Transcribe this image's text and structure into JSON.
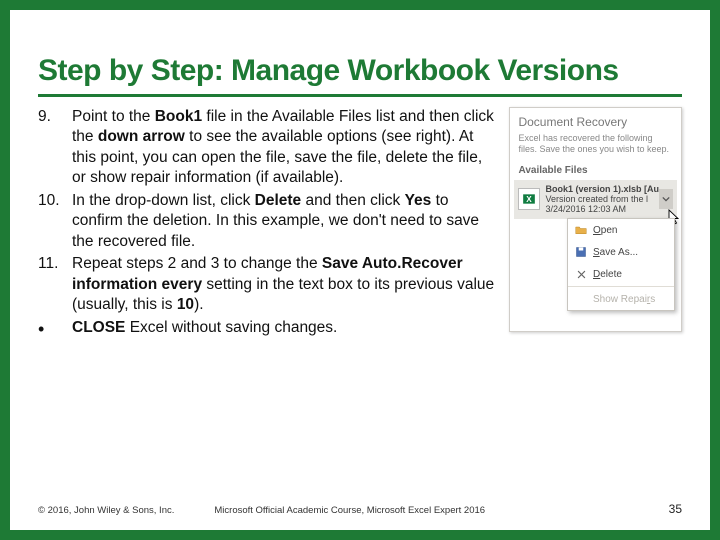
{
  "title": "Step by Step: Manage Workbook Versions",
  "steps": [
    {
      "num": "9.",
      "segments": [
        {
          "t": "Point to the "
        },
        {
          "t": "Book1",
          "b": true
        },
        {
          "t": " file in the Available Files list and then click the "
        },
        {
          "t": "down arrow",
          "b": true
        },
        {
          "t": " to see the available options (see right). At this point, you can open the file, save the file, delete the file, or show repair information (if available)."
        }
      ]
    },
    {
      "num": "10.",
      "segments": [
        {
          "t": "In the drop-down list, click "
        },
        {
          "t": "Delete",
          "b": true
        },
        {
          "t": " and then click "
        },
        {
          "t": "Yes",
          "b": true
        },
        {
          "t": " to confirm the deletion. In this example, we don't need to save the recovered file."
        }
      ]
    },
    {
      "num": "11.",
      "segments": [
        {
          "t": "Repeat steps 2 and 3 to change the "
        },
        {
          "t": "Save Auto.Recover information every",
          "b": true
        },
        {
          "t": " setting in the text box to its previous value (usually, this is "
        },
        {
          "t": "10",
          "b": true
        },
        {
          "t": ")."
        }
      ]
    }
  ],
  "bullet": {
    "mark": "•",
    "segments": [
      {
        "t": "CLOSE",
        "b": true
      },
      {
        "t": " Excel without saving changes."
      }
    ]
  },
  "figure": {
    "title": "Document Recovery",
    "subtitle": "Excel has recovered the following files. Save the ones you wish to keep.",
    "available_label": "Available Files",
    "file": {
      "name": "Book1 (version 1).xlsb  [Au",
      "line2": "Version created from the l",
      "line3": "3/24/2016 12:03 AM"
    },
    "menu": {
      "open": "Open",
      "save_as": "Save As...",
      "delete": "Delete",
      "show_repairs": "Show Repairs"
    }
  },
  "footer": {
    "left": "© 2016, John Wiley & Sons, Inc.",
    "mid": "Microsoft Official Academic Course, Microsoft Excel Expert 2016",
    "right": "35"
  }
}
